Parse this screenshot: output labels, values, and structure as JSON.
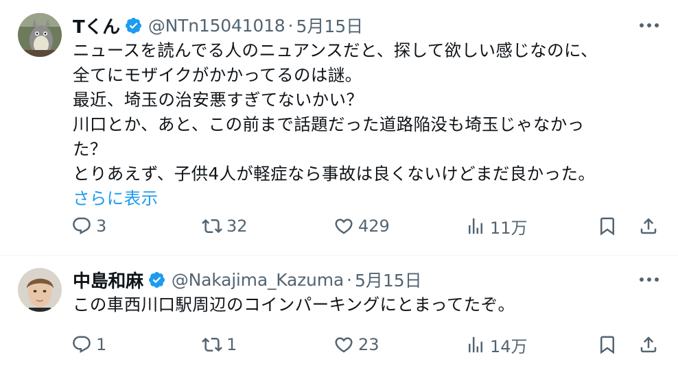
{
  "tweets": [
    {
      "author": {
        "name": "Tくん",
        "handle": "@NTn15041018",
        "date": "5月15日",
        "verified": true,
        "avatar": "totoro-figure-avatar"
      },
      "text_lines": [
        "ニュースを読んでる人のニュアンスだと、探して欲しい感じなのに、",
        "全てにモザイクがかかってるのは謎。",
        "最近、埼玉の治安悪すぎてないかい？",
        "川口とか、あと、この前まで話題だった道路陥没も埼玉じゃなかっ",
        "た？",
        "とりあえず、子供4人が軽症なら事故は良くないけどまだ良かった。"
      ],
      "show_more": "さらに表示",
      "stats": {
        "replies": "3",
        "reposts": "32",
        "likes": "429",
        "views": "11万"
      }
    },
    {
      "author": {
        "name": "中島和麻",
        "handle": "@Nakajima_Kazuma",
        "date": "5月15日",
        "verified": true,
        "avatar": "person-photo-avatar"
      },
      "text_lines": [
        "この車西川口駅周辺のコインパーキングにとまってたぞ。"
      ],
      "stats": {
        "replies": "1",
        "reposts": "1",
        "likes": "23",
        "views": "14万"
      }
    }
  ],
  "colors": {
    "text": "#0f1419",
    "secondary": "#536471",
    "link": "#1d9bf0",
    "verified": "#1d9bf0",
    "divider": "#eff3f4"
  },
  "separator": "·"
}
